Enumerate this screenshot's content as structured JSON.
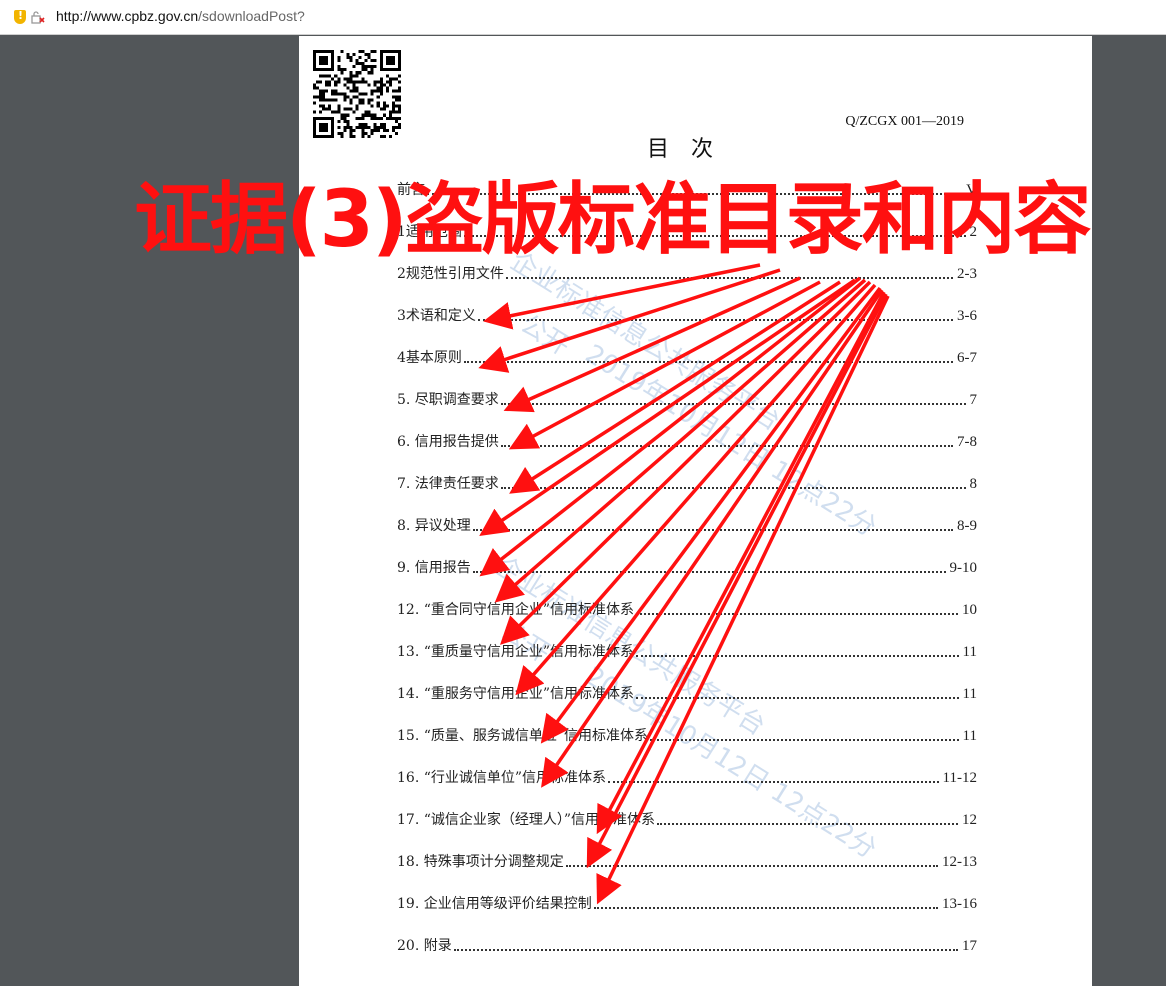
{
  "browser": {
    "url_domain": "http://www.cpbz.gov.cn",
    "url_path": "/sdownloadPost?",
    "security_icon": "shield-warning-icon",
    "lock_icon": "broken-lock-icon"
  },
  "document": {
    "standard_code": "Q/ZCGX 001—2019",
    "toc_title": "目次",
    "entries": [
      {
        "label": "前言",
        "page": "V"
      },
      {
        "label": "1适用范围",
        "page": "2"
      },
      {
        "label": "2规范性引用文件",
        "page": "2-3"
      },
      {
        "label": "3术语和定义",
        "page": "3-6"
      },
      {
        "label": "4基本原则",
        "page": "6-7"
      },
      {
        "label": "5. 尽职调查要求",
        "page": "7"
      },
      {
        "label": "6. 信用报告提供",
        "page": "7-8"
      },
      {
        "label": "7. 法律责任要求",
        "page": "8"
      },
      {
        "label": "8. 异议处理",
        "page": "8-9"
      },
      {
        "label": "9. 信用报告",
        "page": "9-10"
      },
      {
        "label": "12. “重合同守信用企业”信用标准体系",
        "page": "10"
      },
      {
        "label": "13. “重质量守信用企业”信用标准体系",
        "page": "11"
      },
      {
        "label": "14. “重服务守信用企业”信用标准体系",
        "page": "11"
      },
      {
        "label": "15. “质量、服务诚信单位”信用标准体系",
        "page": "11"
      },
      {
        "label": "16. “行业诚信单位”信用标准体系",
        "page": "11-12"
      },
      {
        "label": "17. “诚信企业家（经理人）”信用标准体系",
        "page": "12"
      },
      {
        "label": "18. 特殊事项计分调整规定",
        "page": "12-13"
      },
      {
        "label": "19. 企业信用等级评价结果控制",
        "page": "13-16"
      },
      {
        "label": "20. 附录",
        "page": "17"
      }
    ],
    "watermarks": [
      "企业标准信息公共服务平台",
      "公开",
      "2019年10月12日 12点22分",
      "企业标准信息公共服务平台",
      "公开",
      "2019年10月12日 12点22分"
    ]
  },
  "annotation": {
    "headline": "证据(3)盗版标准目录和内容",
    "color": "#ff1010"
  },
  "colors": {
    "viewer_bg": "#525659",
    "page_bg": "#ffffff",
    "annotation_red": "#ff1010"
  }
}
